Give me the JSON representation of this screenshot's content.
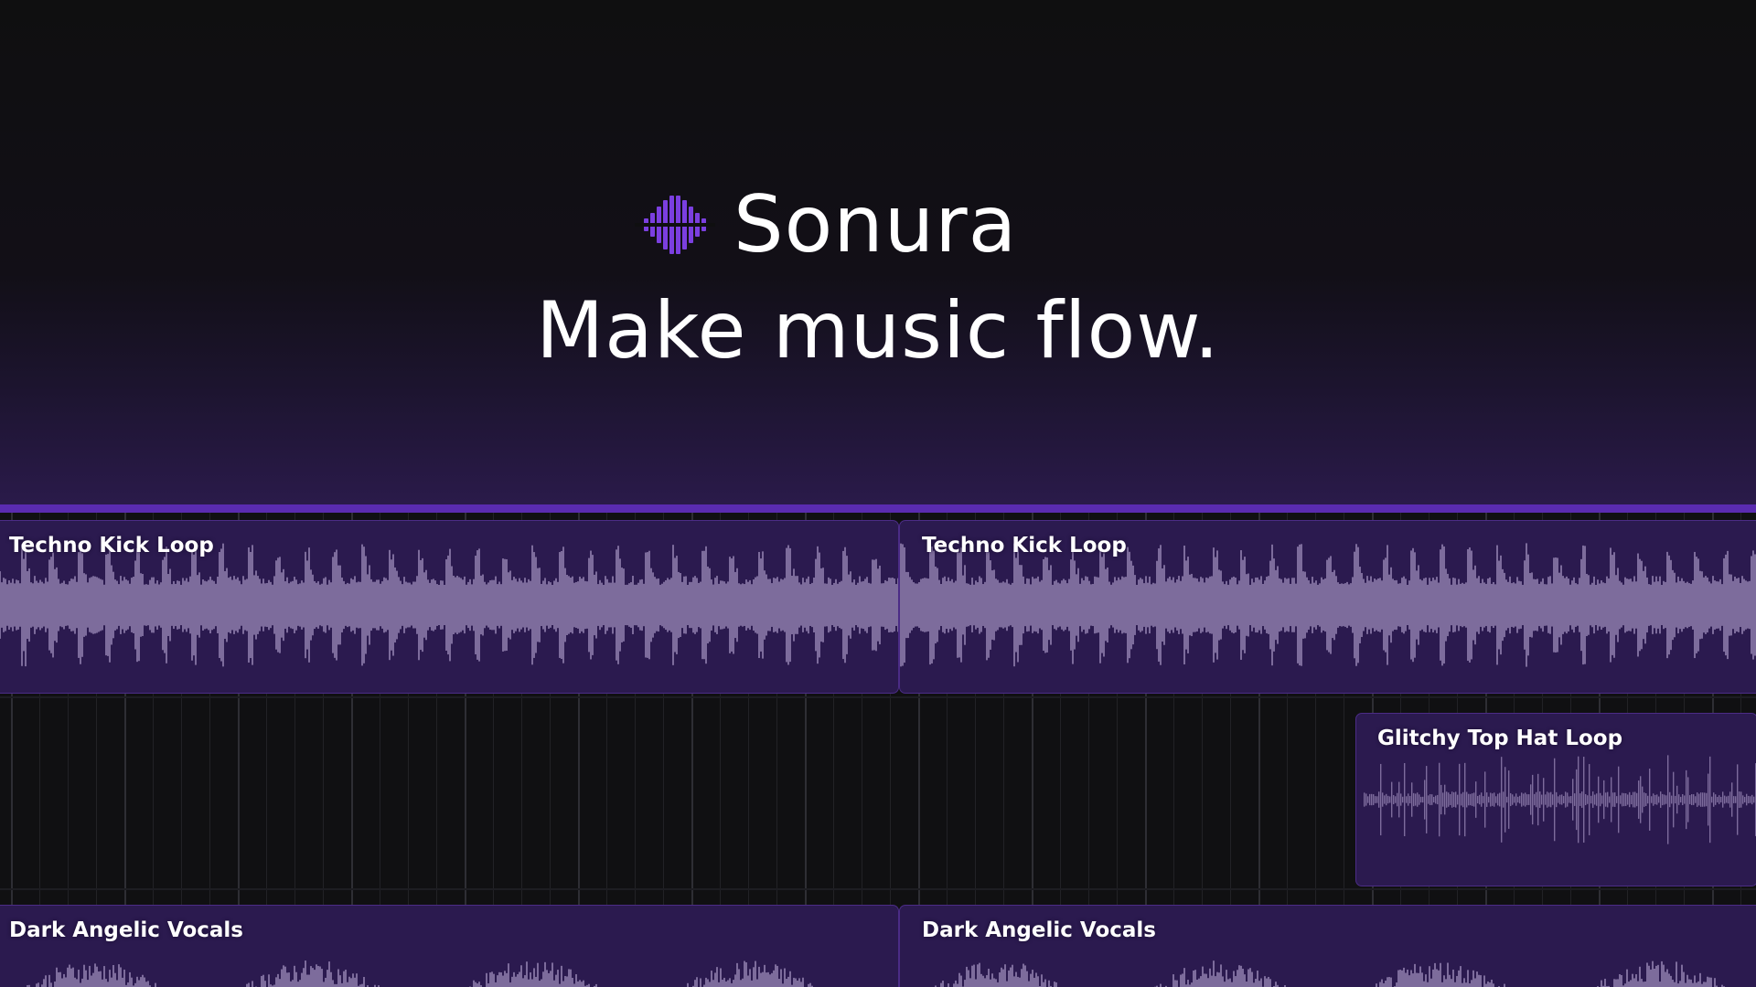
{
  "brand": {
    "name": "Sonura",
    "logo_icon": "sonura-waveform-diamond-icon",
    "accent_color": "#7b3fe0"
  },
  "hero": {
    "tagline": "Make music flow."
  },
  "timeline": {
    "colors": {
      "background": "#101012",
      "clip_fill": "#2b1a4f",
      "clip_border": "#4b2c86",
      "waveform": "#7d6c9c",
      "playhead_bar": "#5a2bb0"
    },
    "tracks": [
      {
        "clips": [
          {
            "label": "Techno Kick Loop",
            "waveform": "kick"
          },
          {
            "label": "Techno Kick Loop",
            "waveform": "kick"
          }
        ]
      },
      {
        "clips": [
          {
            "label": "Glitchy Top Hat Loop",
            "waveform": "hat"
          }
        ]
      },
      {
        "clips": [
          {
            "label": "Dark Angelic Vocals",
            "waveform": "vocal"
          },
          {
            "label": "Dark Angelic Vocals",
            "waveform": "vocal"
          }
        ]
      }
    ]
  }
}
